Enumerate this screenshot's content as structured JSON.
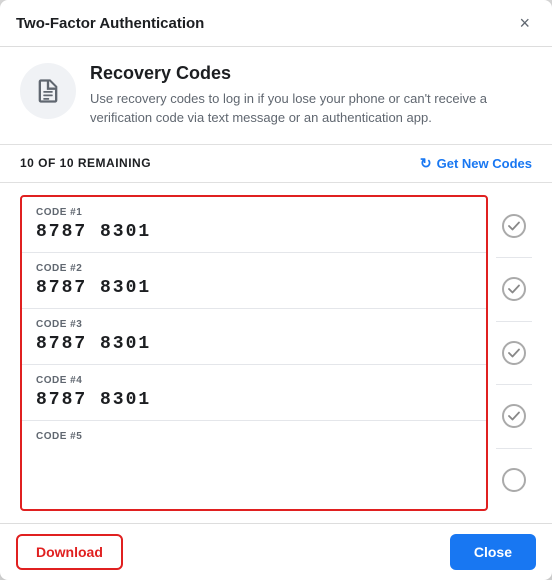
{
  "modal": {
    "title": "Two-Factor Authentication",
    "close_label": "×"
  },
  "info": {
    "heading": "Recovery Codes",
    "description": "Use recovery codes to log in if you lose your phone or can't receive a verification code via text message or an authentication app."
  },
  "remaining": {
    "label": "10 OF 10 REMAINING"
  },
  "get_new_codes": {
    "label": "Get New Codes"
  },
  "codes": [
    {
      "label": "CODE #1",
      "value": "8787 8301",
      "checked": true
    },
    {
      "label": "CODE #2",
      "value": "8787 8301",
      "checked": true
    },
    {
      "label": "CODE #3",
      "value": "8787 8301",
      "checked": true
    },
    {
      "label": "CODE #4",
      "value": "8787 8301",
      "checked": true
    },
    {
      "label": "CODE #5",
      "value": "",
      "checked": false
    }
  ],
  "footer": {
    "download_label": "Download",
    "close_label": "Close"
  }
}
